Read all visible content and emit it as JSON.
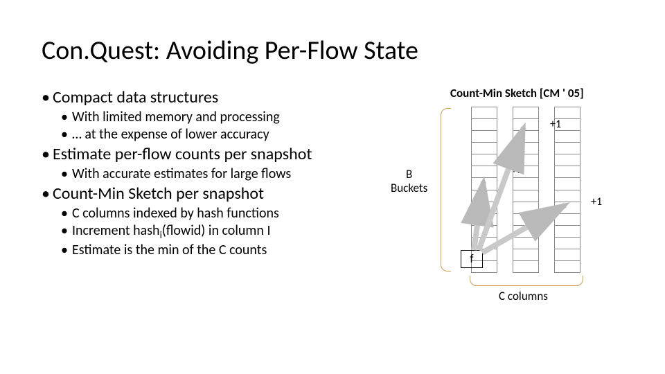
{
  "title": "Con.Quest: Avoiding Per-Flow State",
  "bullets": {
    "b1": "Compact data structures",
    "b1a": "With limited memory and processing",
    "b1b": "… at the expense of lower accuracy",
    "b2": "Estimate per-flow counts per snapshot",
    "b2a": "With accurate estimates for large flows",
    "b3": "Count-Min Sketch per snapshot",
    "b3a": "C columns indexed by hash functions",
    "b3b_pre": "Increment hash",
    "b3b_sub": "i",
    "b3b_post": "(flowid) in column I",
    "b3c": "Estimate is the min of the C counts"
  },
  "diagram": {
    "caption": "Count-Min Sketch [CM ' 05]",
    "buckets_line1": "B",
    "buckets_line2": "Buckets",
    "columns": "C columns",
    "plus1": "+1",
    "f": "f"
  }
}
